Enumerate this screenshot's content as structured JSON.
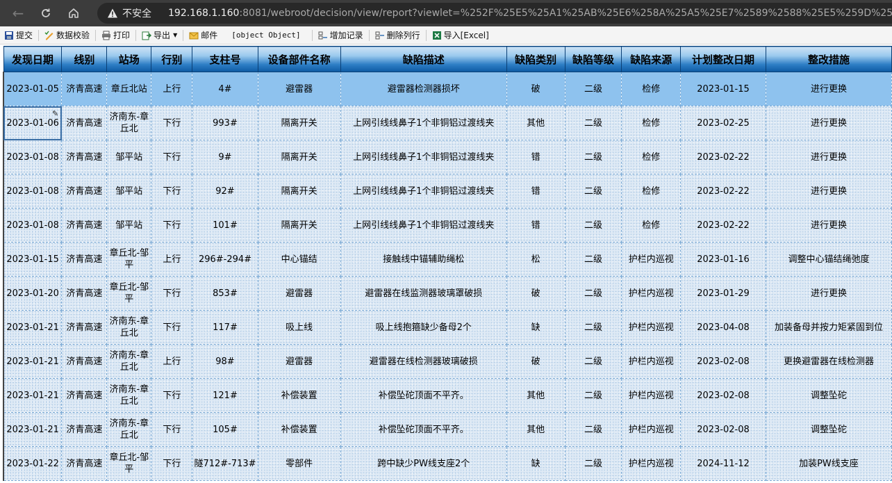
{
  "browser": {
    "insecure_label": "不安全",
    "url_host": "192.168.1.160",
    "url_rest": ":8081/webroot/decision/view/report?viewlet=%252F%25E5%25A1%25AB%25E6%258A%25A5%25E7%2589%2588%25E5%259D%2597%252F%25E6%258"
  },
  "toolbar": {
    "submit": "提交",
    "validate": "数据校验",
    "print": "打印",
    "export": "导出",
    "mail": "邮件",
    "object": "[object Object]",
    "add_record": "增加记录",
    "delete_row": "删除列行",
    "import_excel": "导入[Excel]"
  },
  "table": {
    "headers": [
      "发现日期",
      "线别",
      "站场",
      "行别",
      "支柱号",
      "设备部件名称",
      "缺陷描述",
      "缺陷类别",
      "缺陷等级",
      "缺陷来源",
      "计划整改日期",
      "整改措施"
    ],
    "rows": [
      [
        "2023-01-05",
        "济青高速",
        "章丘北站",
        "上行",
        "4#",
        "避雷器",
        "避雷器检测器损坏",
        "破",
        "二级",
        "检修",
        "2023-01-15",
        "进行更换"
      ],
      [
        "2023-01-06",
        "济青高速",
        "济南东-章丘北",
        "下行",
        "993#",
        "隔离开关",
        "上网引线线鼻子1个非铜铝过渡线夹",
        "其他",
        "二级",
        "检修",
        "2023-02-25",
        "进行更换"
      ],
      [
        "2023-01-08",
        "济青高速",
        "邹平站",
        "下行",
        "9#",
        "隔离开关",
        "上网引线线鼻子1个非铜铝过渡线夹",
        "错",
        "二级",
        "检修",
        "2023-02-22",
        "进行更换"
      ],
      [
        "2023-01-08",
        "济青高速",
        "邹平站",
        "下行",
        "92#",
        "隔离开关",
        "上网引线线鼻子1个非铜铝过渡线夹",
        "错",
        "二级",
        "检修",
        "2023-02-22",
        "进行更换"
      ],
      [
        "2023-01-08",
        "济青高速",
        "邹平站",
        "下行",
        "101#",
        "隔离开关",
        "上网引线线鼻子1个非铜铝过渡线夹",
        "错",
        "二级",
        "检修",
        "2023-02-22",
        "进行更换"
      ],
      [
        "2023-01-15",
        "济青高速",
        "章丘北-邹平",
        "上行",
        "296#-294#",
        "中心锚结",
        "接触线中锚辅助绳松",
        "松",
        "二级",
        "护栏内巡视",
        "2023-01-16",
        "调整中心锚结绳弛度"
      ],
      [
        "2023-01-20",
        "济青高速",
        "章丘北-邹平",
        "下行",
        "853#",
        "避雷器",
        "避雷器在线监测器玻璃罩破损",
        "破",
        "二级",
        "护栏内巡视",
        "2023-01-29",
        "进行更换"
      ],
      [
        "2023-01-21",
        "济青高速",
        "济南东-章丘北",
        "下行",
        "117#",
        "吸上线",
        "吸上线抱箍缺少备母2个",
        "缺",
        "二级",
        "护栏内巡视",
        "2023-04-08",
        "加装备母并按力矩紧固到位"
      ],
      [
        "2023-01-21",
        "济青高速",
        "济南东-章丘北",
        "上行",
        "98#",
        "避雷器",
        "避雷器在线检测器玻璃破损",
        "破",
        "二级",
        "护栏内巡视",
        "2023-02-08",
        "更换避雷器在线检测器"
      ],
      [
        "2023-01-21",
        "济青高速",
        "济南东-章丘北",
        "下行",
        "121#",
        "补偿装置",
        "补偿坠砣顶面不平齐。",
        "其他",
        "二级",
        "护栏内巡视",
        "2023-02-08",
        "调整坠砣"
      ],
      [
        "2023-01-21",
        "济青高速",
        "济南东-章丘北",
        "下行",
        "105#",
        "补偿装置",
        "补偿坠砣顶面不平齐。",
        "其他",
        "二级",
        "护栏内巡视",
        "2023-02-08",
        "调整坠砣"
      ],
      [
        "2023-01-22",
        "济青高速",
        "章丘北-邹平",
        "下行",
        "隧712#-713#",
        "零部件",
        "跨中缺少PW线支座2个",
        "缺",
        "二级",
        "护栏内巡视",
        "2024-11-12",
        "加装PW线支座"
      ]
    ]
  },
  "colors": {
    "header_dark": "#0d5aa3",
    "selected_row": "#8ec2ee",
    "cell_bg": "#dfeaf5"
  },
  "icons": {
    "back": "arrow-left-icon",
    "reload": "reload-icon",
    "home": "home-icon",
    "warning": "warning-triangle-icon"
  }
}
